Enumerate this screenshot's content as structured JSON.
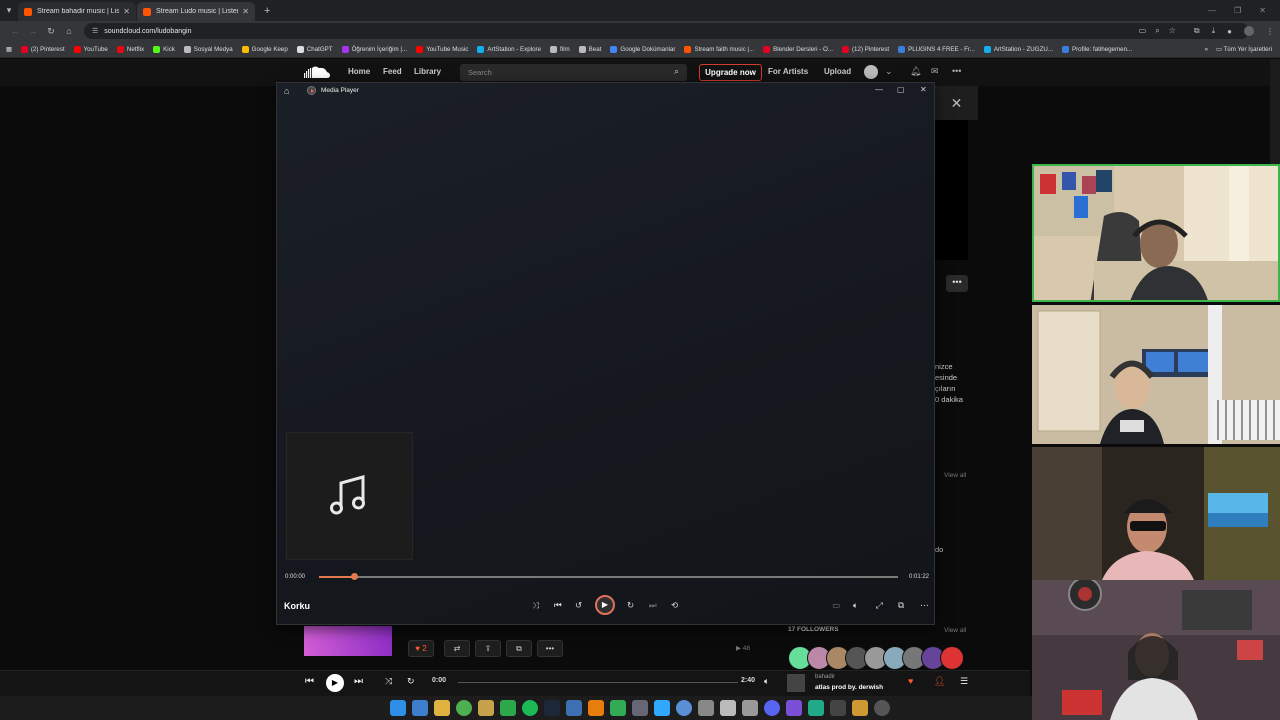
{
  "browser": {
    "tabs": [
      {
        "title": "Stream bahadir music | Listen to"
      },
      {
        "title": "Stream Ludo music | Listen to"
      }
    ],
    "url": "soundcloud.com/ludobangin",
    "bookmarks": [
      {
        "label": "(2) Pinterest",
        "color": "#e60023"
      },
      {
        "label": "YouTube",
        "color": "#ff0000"
      },
      {
        "label": "Netflix",
        "color": "#e50914"
      },
      {
        "label": "Kick",
        "color": "#53fc18"
      },
      {
        "label": "Sosyal Medya",
        "color": "#bbbbbb"
      },
      {
        "label": "Google Keep",
        "color": "#fbbc04"
      },
      {
        "label": "ChatGPT",
        "color": "#dddddd"
      },
      {
        "label": "Öğrenim İçeriğim |...",
        "color": "#a435f0"
      },
      {
        "label": "YouTube Music",
        "color": "#ff0000"
      },
      {
        "label": "ArtStation - Explore",
        "color": "#13aff0"
      },
      {
        "label": "film",
        "color": "#bbbbbb"
      },
      {
        "label": "Beat",
        "color": "#bbbbbb"
      },
      {
        "label": "Google Dokümanlar",
        "color": "#4285f4"
      },
      {
        "label": "Stream faith music |...",
        "color": "#ff5500"
      },
      {
        "label": "Blender Dersleri - O...",
        "color": "#e60023"
      },
      {
        "label": "(12) Pinterest",
        "color": "#e60023"
      },
      {
        "label": "PLUGINS 4 FREE - Fr...",
        "color": "#3b7dd8"
      },
      {
        "label": "ArtStation - ZUGZU...",
        "color": "#13aff0"
      },
      {
        "label": "Profile: fatihegemen...",
        "color": "#3b7dd8"
      }
    ],
    "all_bookmarks": "Tüm Yer İşaretleri"
  },
  "soundcloud": {
    "nav": {
      "home": "Home",
      "feed": "Feed",
      "library": "Library"
    },
    "search_placeholder": "Search",
    "upgrade": "Upgrade now",
    "for_artists": "For Artists",
    "upload": "Upload",
    "fragments": [
      "nizce",
      "esinde",
      "çıların",
      "0 dakika"
    ],
    "view_all": "View all",
    "fragment_do": "do",
    "followers": "17 FOLLOWERS",
    "track_like_count": "2",
    "track_plays": "▶ 48"
  },
  "player_bar": {
    "current_time": "0:00",
    "duration": "2:40",
    "artist": "bahadir",
    "title": "atlas prod by. derwish"
  },
  "media_player": {
    "window_title": "Media Player",
    "track_title": "Korku",
    "current_time": "0:00:00",
    "total_time": "0:01:22",
    "progress_fraction": 0.06,
    "accent_color": "#e27a4b"
  }
}
